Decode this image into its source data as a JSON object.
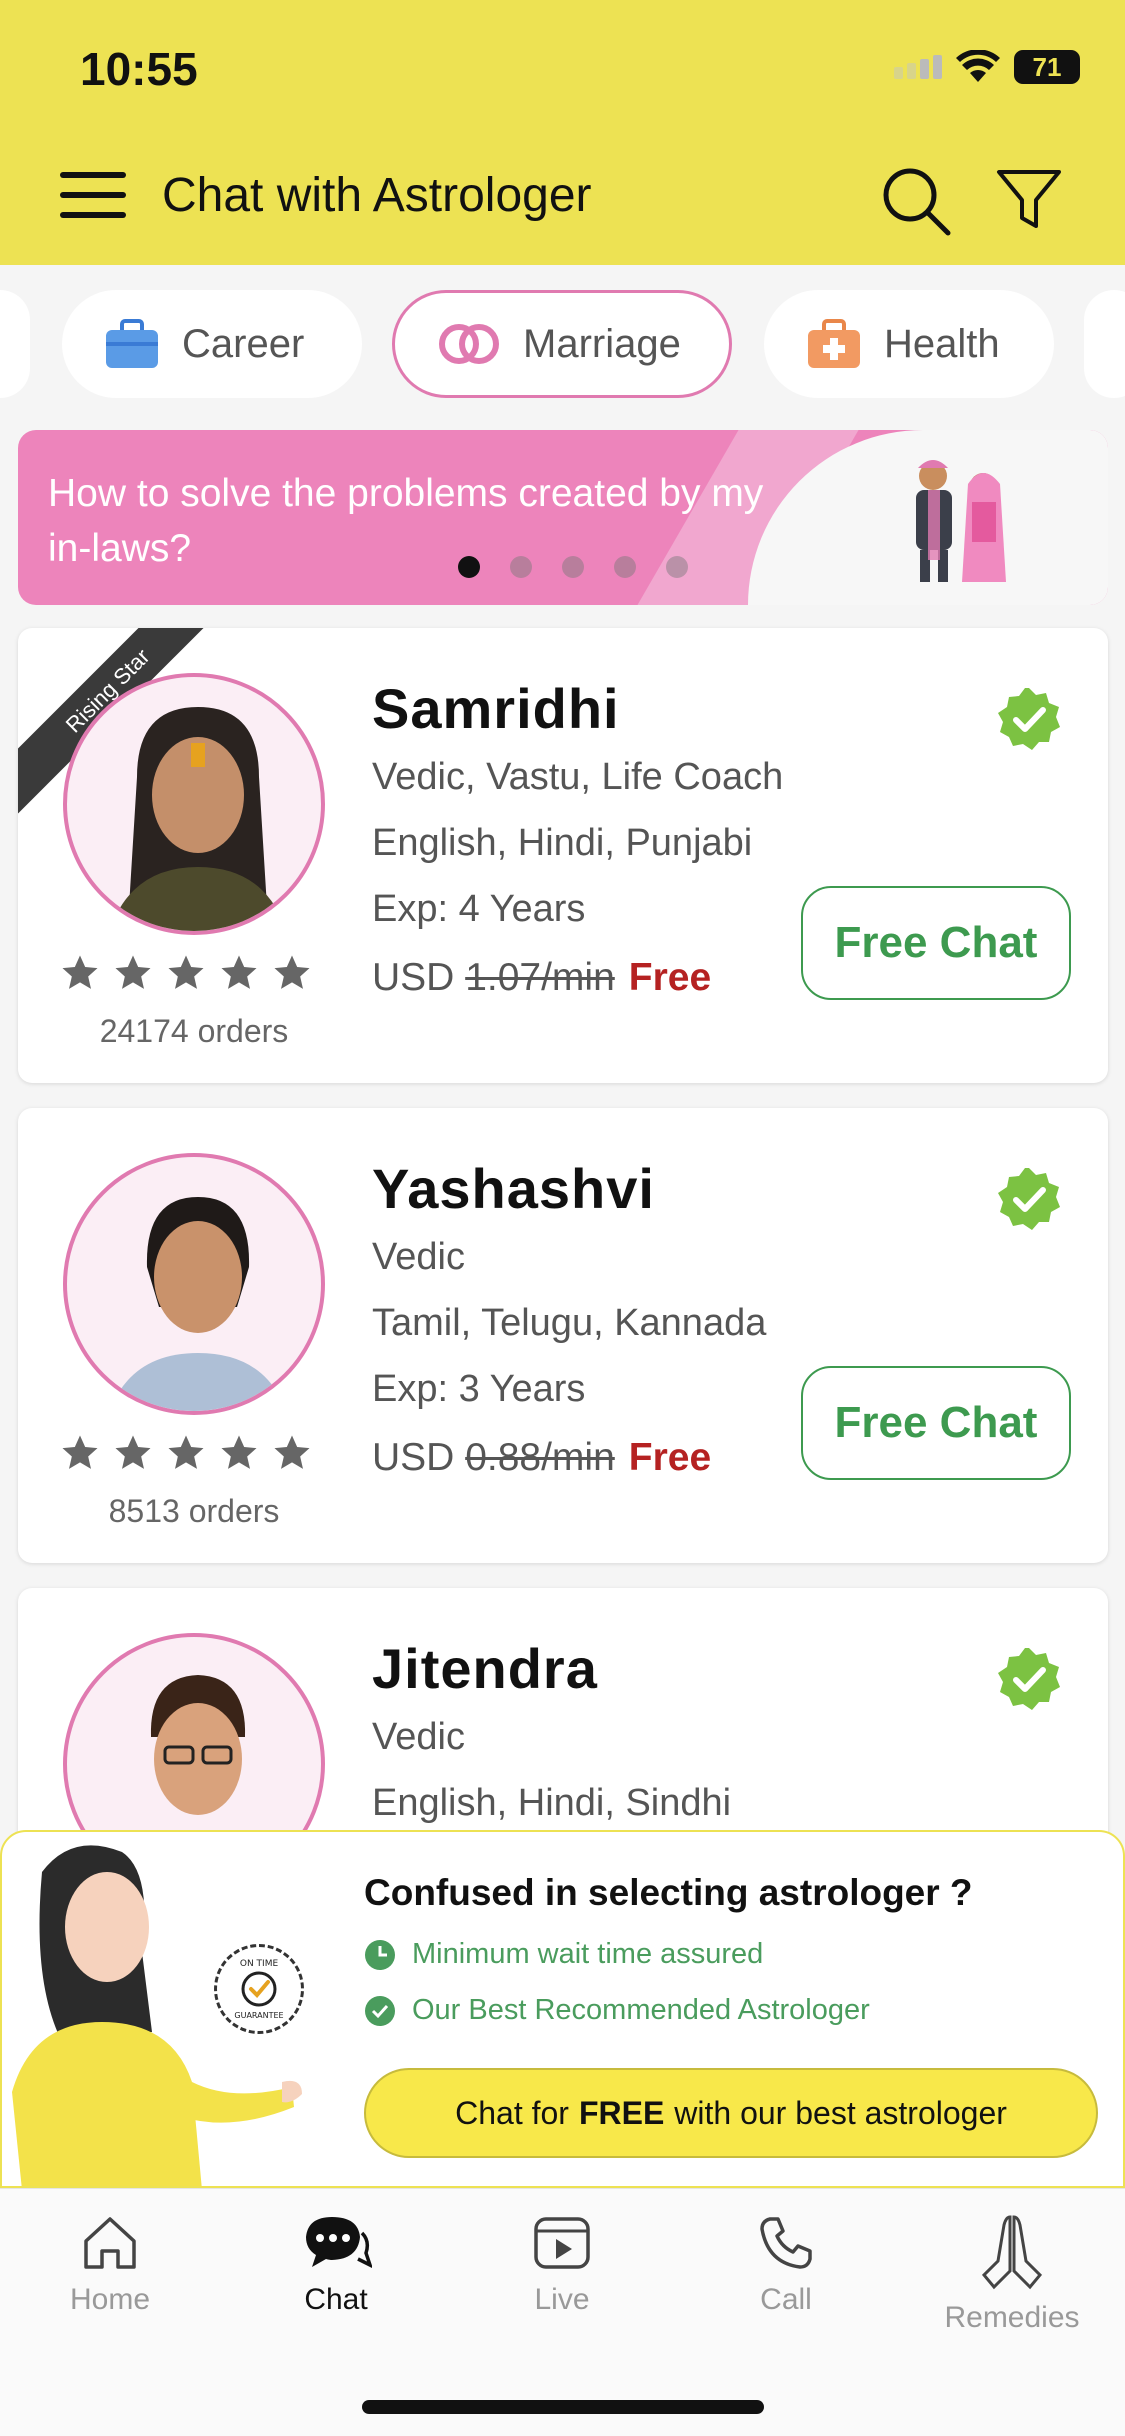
{
  "status": {
    "time": "10:55",
    "battery": "71"
  },
  "header": {
    "title": "Chat with Astrologer"
  },
  "categories": [
    {
      "label": "Career",
      "icon": "briefcase-icon"
    },
    {
      "label": "Marriage",
      "icon": "rings-icon",
      "active": true
    },
    {
      "label": "Health",
      "icon": "medical-kit-icon"
    }
  ],
  "banner": {
    "text": "How to solve the problems created by my in-laws?",
    "active_slide": 1,
    "slides": 5
  },
  "astrologers": [
    {
      "name": "Samridhi",
      "badge": "Rising Star",
      "skills": "Vedic,  Vastu,  Life Coach",
      "languages": "English, Hindi, Punjabi",
      "experience": "Exp: 4 Years",
      "currency": "USD",
      "old_price": "1.07/min",
      "price": "Free",
      "orders": "24174 orders",
      "rating": 5,
      "cta": "Free Chat"
    },
    {
      "name": "Yashashvi",
      "skills": "Vedic",
      "languages": "Tamil, Telugu, Kannada",
      "experience": "Exp: 3 Years",
      "currency": "USD",
      "old_price": "0.88/min",
      "price": "Free",
      "orders": "8513 orders",
      "rating": 5,
      "cta": "Free Chat"
    },
    {
      "name": "Jitendra",
      "skills": "Vedic",
      "languages": "English, Hindi, Sindhi"
    }
  ],
  "promo": {
    "title": "Confused in selecting astrologer ?",
    "point1": "Minimum wait time assured",
    "point2": "Our Best Recommended Astrologer",
    "cta_prefix": "Chat for",
    "cta_bold": "FREE",
    "cta_suffix": "with our best astrologer",
    "seal": "ON TIME GUARANTEE"
  },
  "nav": [
    {
      "label": "Home",
      "icon": "home-icon"
    },
    {
      "label": "Chat",
      "icon": "chat-icon",
      "active": true
    },
    {
      "label": "Live",
      "icon": "live-icon"
    },
    {
      "label": "Call",
      "icon": "phone-icon"
    },
    {
      "label": "Remedies",
      "icon": "praying-hands-icon"
    }
  ],
  "colors": {
    "header": "#ede253",
    "accent_pink": "#e07ab0",
    "green": "#3d9a4f",
    "price_red": "#b52222"
  }
}
